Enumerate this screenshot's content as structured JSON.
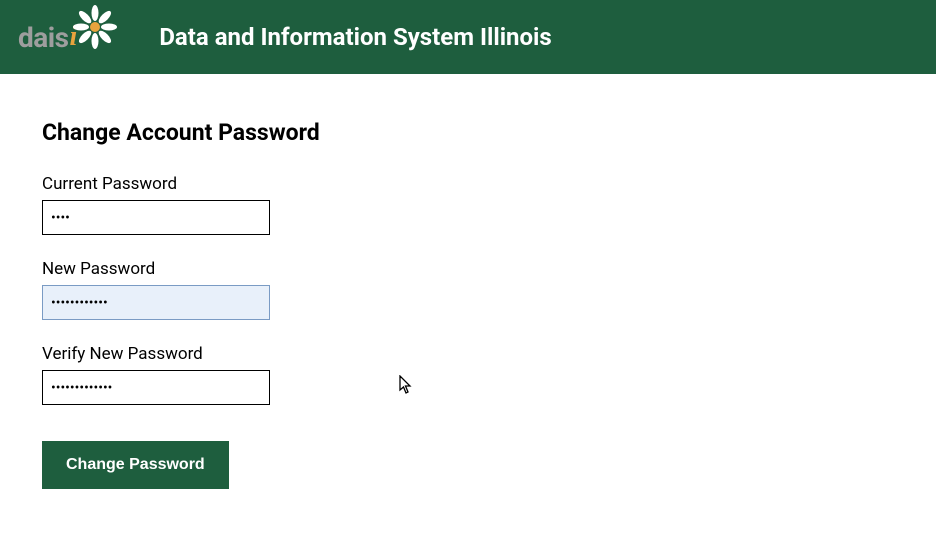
{
  "header": {
    "logo_text": "dais",
    "logo_accent": "i",
    "title": "Data and Information System Illinois"
  },
  "page": {
    "title": "Change Account Password"
  },
  "form": {
    "current_password": {
      "label": "Current Password",
      "value": "••••"
    },
    "new_password": {
      "label": "New Password",
      "value": "••••••••••••"
    },
    "verify_password": {
      "label": "Verify New Password",
      "value": "•••••••••••••"
    },
    "submit_label": "Change Password"
  },
  "colors": {
    "brand_green": "#1e5e3e",
    "accent_gold": "#e8a33d",
    "logo_grey": "#9e9e9e"
  }
}
